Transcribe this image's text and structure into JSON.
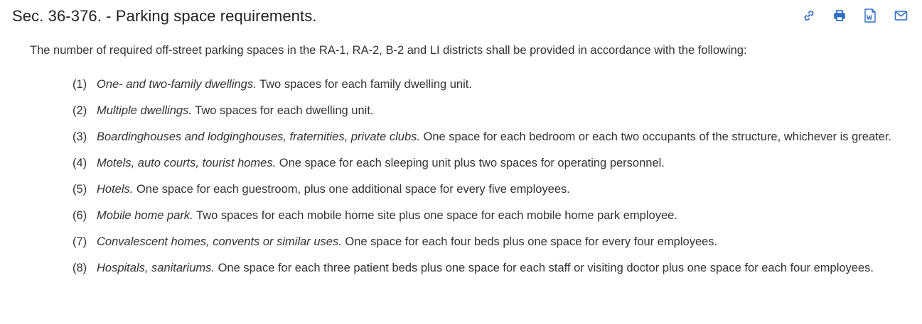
{
  "title": "Sec. 36-376. - Parking space requirements.",
  "toolbar": {
    "icons": [
      "link-icon",
      "print-icon",
      "word-document-icon",
      "email-icon"
    ],
    "accent_color": "#2f6fc6"
  },
  "intro": "The number of required off-street parking spaces in the RA-1, RA-2, B-2 and LI districts shall be provided in accordance with the following:",
  "items": [
    {
      "num": "(1)",
      "term": "One- and two-family dwellings.",
      "text": " Two spaces for each family dwelling unit."
    },
    {
      "num": "(2)",
      "term": "Multiple dwellings.",
      "text": " Two spaces for each dwelling unit."
    },
    {
      "num": "(3)",
      "term": "Boardinghouses and lodginghouses, fraternities, private clubs.",
      "text": " One space for each bedroom or each two occupants of the structure, whichever is greater."
    },
    {
      "num": "(4)",
      "term": "Motels, auto courts, tourist homes.",
      "text": " One space for each sleeping unit plus two spaces for operating personnel."
    },
    {
      "num": "(5)",
      "term": "Hotels.",
      "text": " One space for each guestroom, plus one additional space for every five employees."
    },
    {
      "num": "(6)",
      "term": "Mobile home park.",
      "text": " Two spaces for each mobile home site plus one space for each mobile home park employee."
    },
    {
      "num": "(7)",
      "term": "Convalescent homes, convents or similar uses.",
      "text": " One space for each four beds plus one space for every four employees."
    },
    {
      "num": "(8)",
      "term": "Hospitals, sanitariums.",
      "text": " One space for each three patient beds plus one space for each staff or visiting doctor plus one space for each four employees."
    }
  ]
}
